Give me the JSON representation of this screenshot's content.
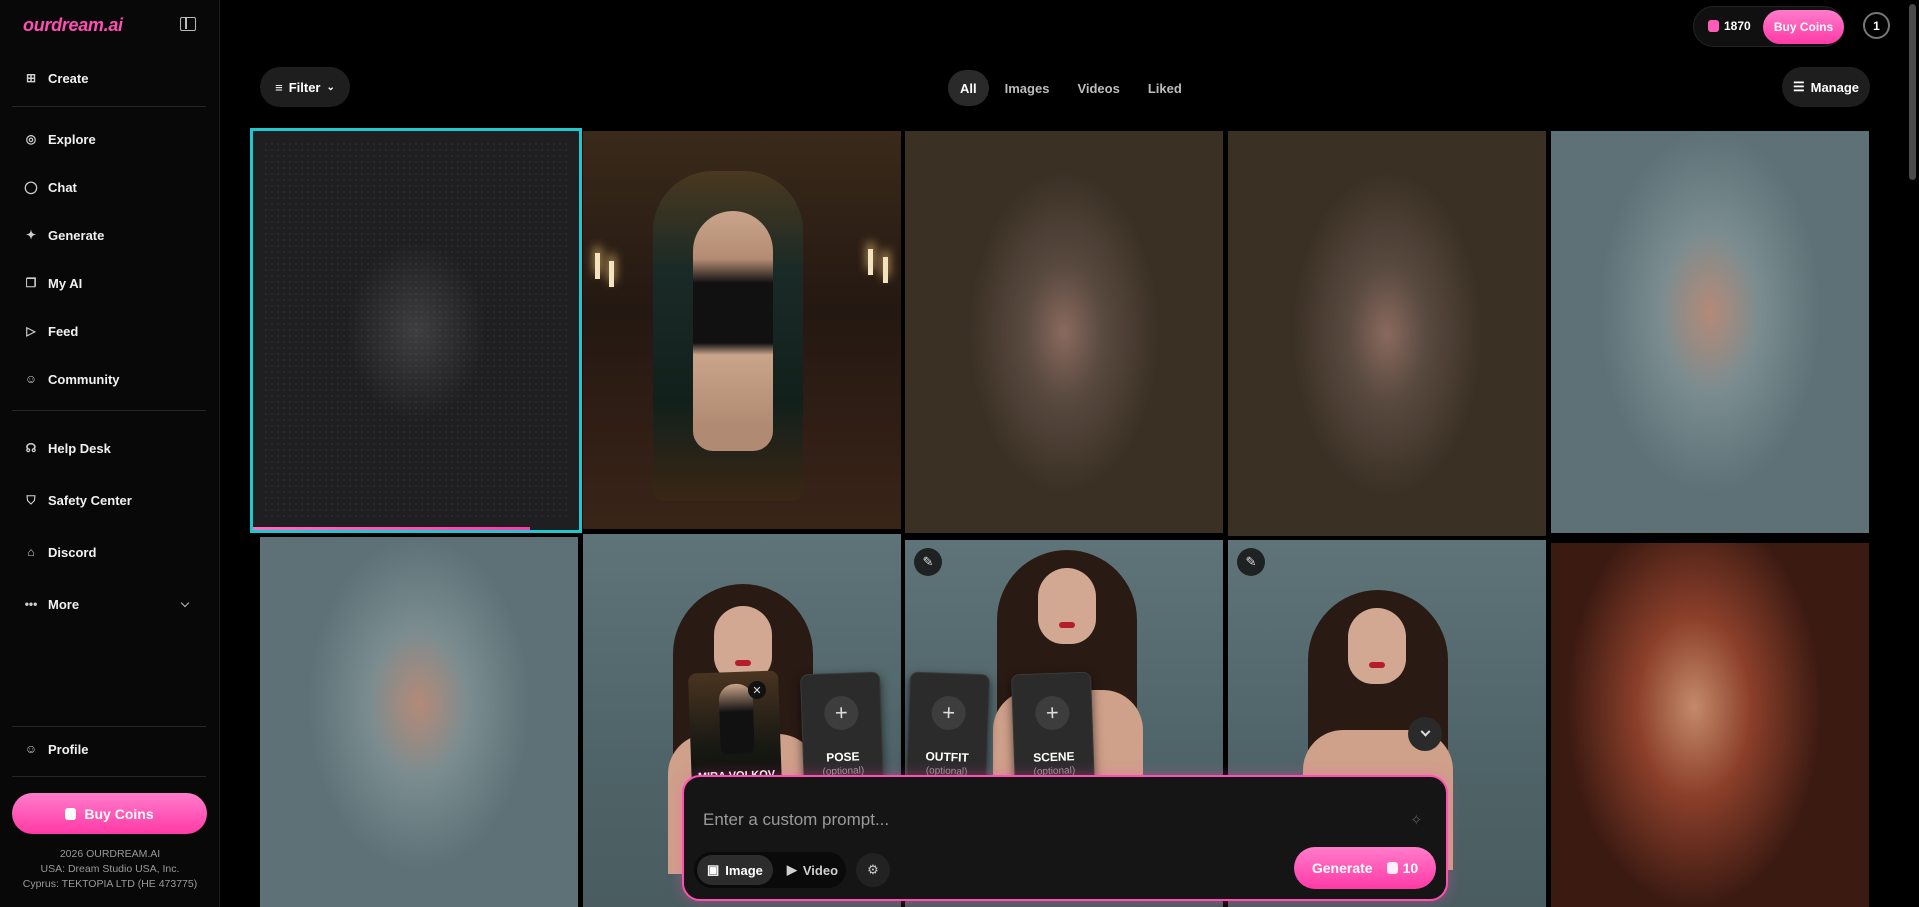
{
  "brand": {
    "logo": "ourdream.ai"
  },
  "sidebar": {
    "items": [
      {
        "label": "Create",
        "icon": "plus-square-icon"
      },
      {
        "label": "Explore",
        "icon": "compass-icon"
      },
      {
        "label": "Chat",
        "icon": "chat-bubble-icon"
      },
      {
        "label": "Generate",
        "icon": "sparkle-icon"
      },
      {
        "label": "My AI",
        "icon": "stack-icon"
      },
      {
        "label": "Feed",
        "icon": "play-square-icon"
      },
      {
        "label": "Community",
        "icon": "users-icon"
      },
      {
        "label": "Help Desk",
        "icon": "headset-icon"
      },
      {
        "label": "Safety Center",
        "icon": "shield-icon"
      },
      {
        "label": "Discord",
        "icon": "discord-icon"
      },
      {
        "label": "More",
        "icon": "more-dots-icon"
      },
      {
        "label": "Profile",
        "icon": "user-icon"
      }
    ],
    "buy_coins": "Buy Coins",
    "footer": [
      "2026 OURDREAM.AI",
      "USA: Dream Studio USA, Inc.",
      "Cyprus: TEKTOPIA LTD (HE 473775)"
    ]
  },
  "topbar": {
    "coins": "1870",
    "buy_coins": "Buy Coins",
    "notification_count": "1"
  },
  "toolbar": {
    "filter": "Filter",
    "tabs": [
      "All",
      "Images",
      "Videos",
      "Liked"
    ],
    "active_tab": "All",
    "manage": "Manage"
  },
  "composer": {
    "character_name": "MIRA VOLKOV",
    "cards": [
      {
        "title": "POSE",
        "sub": "(optional)"
      },
      {
        "title": "OUTFIT",
        "sub": "(optional)"
      },
      {
        "title": "SCENE",
        "sub": "(optional)"
      }
    ],
    "placeholder": "Enter a custom prompt...",
    "modes": [
      "Image",
      "Video"
    ],
    "active_mode": "Image",
    "generate": "Generate",
    "cost": "10"
  },
  "colors": {
    "accent": "#ff4fb3",
    "selected_border": "#1fc7cf"
  }
}
